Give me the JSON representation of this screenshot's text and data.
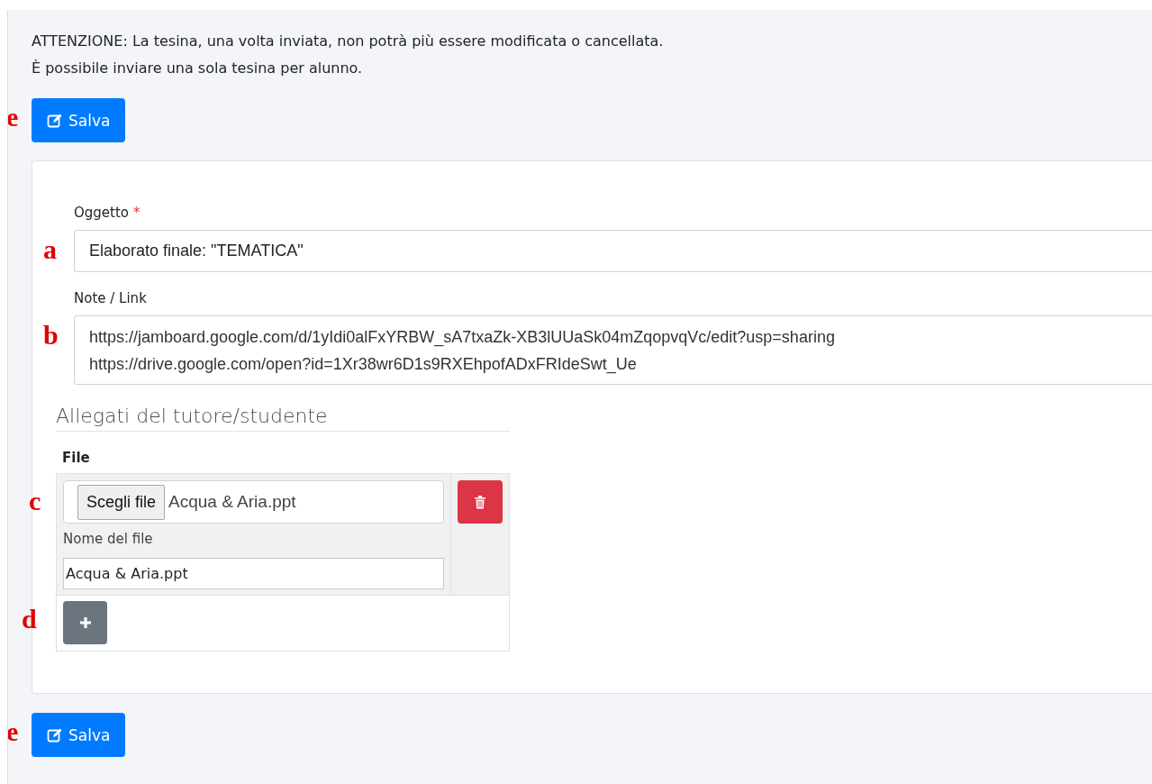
{
  "notice": [
    "ATTENZIONE: La tesina, una volta inviata, non potrà più essere modificata o cancellata.",
    "È possibile inviare una sola tesina per alunno."
  ],
  "top_button": {
    "label": "Salva",
    "marker": "e"
  },
  "form": {
    "fields": [
      {
        "kind": "input",
        "label": "Oggetto",
        "required_mark": "*",
        "value": "Elaborato finale: \"TEMATICA\"",
        "marker": "a"
      },
      {
        "kind": "textarea",
        "label": "Note / Link",
        "lines": [
          "https://jamboard.google.com/d/1yIdi0alFxYRBW_sA7txaZk-XB3lUUaSk04mZqopvqVc/edit?usp=sharing",
          "https://drive.google.com/open?id=1Xr38wr6D1s9RXEhpofADxFRIdeSwt_Ue"
        ],
        "marker": "b"
      }
    ]
  },
  "attachments": {
    "title": "Allegati del tutore/studente",
    "column": "File",
    "rows": [
      {
        "choose_button": "Scegli file",
        "chosen_file": "Acqua & Aria.ppt",
        "name_label": "Nome del file",
        "name_value": "Acqua & Aria.ppt",
        "marker": "c"
      }
    ],
    "add_button": {
      "marker": "d"
    }
  },
  "bottom_button": {
    "label": "Salva",
    "marker": "e"
  }
}
